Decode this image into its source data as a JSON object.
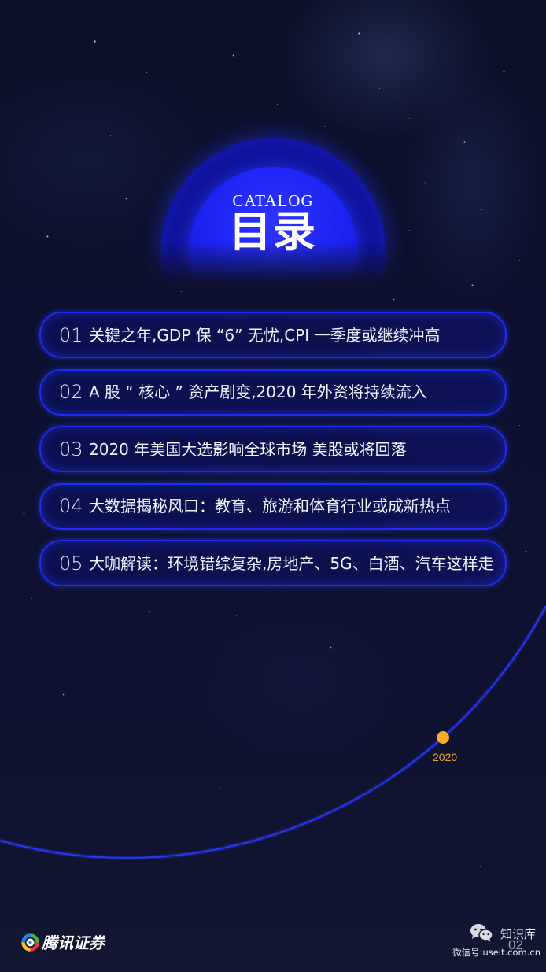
{
  "header": {
    "catalog_label": "CATALOG",
    "title": "目录"
  },
  "items": [
    {
      "number": "01",
      "title": "关键之年,GDP 保 “6” 无忧,CPI 一季度或继续冲高"
    },
    {
      "number": "02",
      "title": "A 股 “ 核心 ” 资产剧变,2020 年外资将持续流入"
    },
    {
      "number": "03",
      "title": "2020 年美国大选影响全球市场 美股或将回落"
    },
    {
      "number": "04",
      "title": "大数据揭秘风口：教育、旅游和体育行业或成新热点"
    },
    {
      "number": "05",
      "title": "大咖解读：环境错综复杂,房地产、5G、白酒、汽车这样走"
    }
  ],
  "timeline": {
    "year_label": "2020"
  },
  "footer": {
    "brand_icon": "tencent-securities-logo-icon",
    "brand_name": "腾讯证券",
    "watermark_icon": "wechat-icon",
    "watermark_name": "知识库",
    "watermark_id": "微信号:useit.com.cn",
    "page_number": "02"
  },
  "colors": {
    "background": "#0d1131",
    "accent_blue": "#2a38ff",
    "item_fill": "#0c1150",
    "timeline_dot": "#f8ab26",
    "year_label": "#e9a33a"
  }
}
